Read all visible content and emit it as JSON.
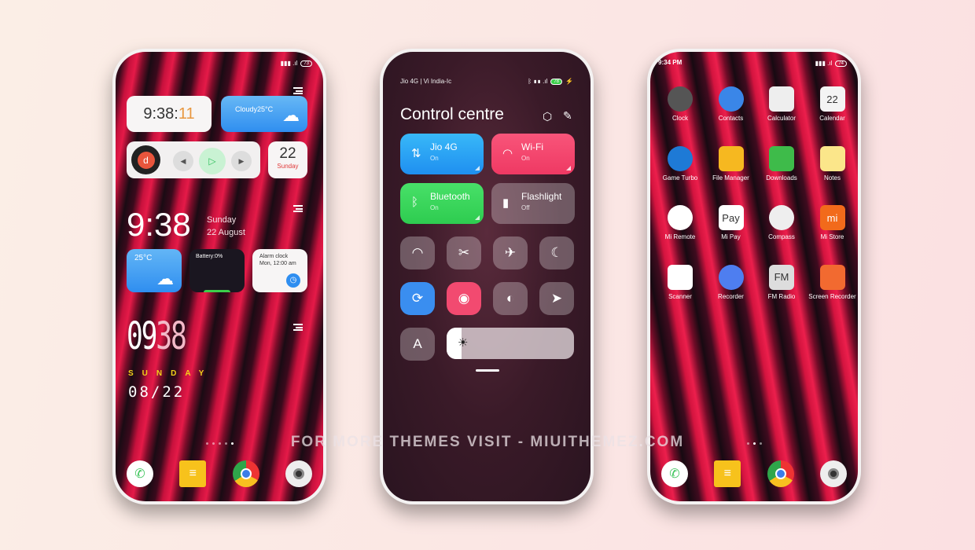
{
  "phone1": {
    "status": {
      "battery": "73"
    },
    "clock_widget": {
      "hm": "9:38:",
      "sec": "11"
    },
    "weather_widget": {
      "text": "Cloudy25°C"
    },
    "music_widget": {
      "prev_icon": "prev-icon",
      "play_icon": "play-icon",
      "next_icon": "next-icon"
    },
    "date_widget": {
      "day": "22",
      "weekday": "Sunday"
    },
    "big_clock": {
      "time": "9:38",
      "weekday": "Sunday",
      "date": "22 August"
    },
    "small_weather": {
      "temp": "25°C"
    },
    "battery_widget": {
      "label": "Battery:0%",
      "level_percent": 0
    },
    "alarm_widget": {
      "title": "Alarm clock",
      "time": "Mon, 12:00 am"
    },
    "digital_clock": {
      "hh": "09",
      "mm": "38",
      "weekday": "SUNDAY",
      "date": "08/22"
    },
    "pages": 5,
    "active_page": 5
  },
  "phone2": {
    "status": {
      "carrier": "Jio 4G | Vi India-Ic",
      "battery": "78"
    },
    "title": "Control centre",
    "tiles": [
      {
        "label": "Jio 4G",
        "state": "On",
        "color": "#2fa6f5"
      },
      {
        "label": "Wi-Fi",
        "state": "On",
        "color": "#f2456a"
      },
      {
        "label": "Bluetooth",
        "state": "On",
        "color": "#33cc55"
      },
      {
        "label": "Flashlight",
        "state": "Off",
        "color": "#9a8a92"
      }
    ],
    "toggles": [
      "wifi-hotspot-icon",
      "screenshot-icon",
      "airplane-icon",
      "moon-icon",
      "rotation-lock-icon",
      "eye-icon",
      "contrast-icon",
      "location-icon"
    ],
    "auto_brightness": "A",
    "brightness_percent": 12
  },
  "phone3": {
    "status": {
      "time": "9:34 PM",
      "battery": "74"
    },
    "apps": [
      {
        "label": "Clock",
        "color": "#555"
      },
      {
        "label": "Contacts",
        "color": "#3a86e8"
      },
      {
        "label": "Calculator",
        "color": "#eee"
      },
      {
        "label": "Calendar",
        "color": "#f4f4f4",
        "text": "22"
      },
      {
        "label": "Game Turbo",
        "color": "#1e7ad6"
      },
      {
        "label": "File Manager",
        "color": "#f6b820"
      },
      {
        "label": "Downloads",
        "color": "#3ebb4a"
      },
      {
        "label": "Notes",
        "color": "#fbe68a"
      },
      {
        "label": "Mi Remote",
        "color": "#fff"
      },
      {
        "label": "Mi Pay",
        "color": "#fff",
        "text": "Pay"
      },
      {
        "label": "Compass",
        "color": "#eee"
      },
      {
        "label": "Mi Store",
        "color": "#f26a1b",
        "text": "mi"
      },
      {
        "label": "Scanner",
        "color": "#fff"
      },
      {
        "label": "Recorder",
        "color": "#4e7ef0"
      },
      {
        "label": "FM Radio",
        "color": "#ddd",
        "text": "FM"
      },
      {
        "label": "Screen Recorder",
        "color": "#f26a30"
      }
    ],
    "pages": 3,
    "active_page": 2
  },
  "watermark": "FOR MORE THEMES VISIT - MIUITHEMEZ.COM"
}
